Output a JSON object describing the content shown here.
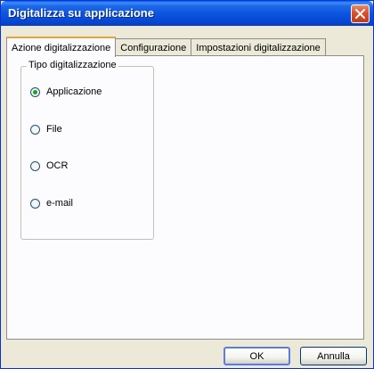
{
  "window": {
    "title": "Digitalizza su applicazione"
  },
  "tabs": [
    {
      "label": "Azione digitalizzazione",
      "active": true
    },
    {
      "label": "Configurazione",
      "active": false
    },
    {
      "label": "Impostazioni digitalizzazione",
      "active": false
    }
  ],
  "scan_type": {
    "legend": "Tipo digitalizzazione",
    "options": [
      {
        "label": "Applicazione",
        "selected": true
      },
      {
        "label": "File",
        "selected": false
      },
      {
        "label": "OCR",
        "selected": false
      },
      {
        "label": "e-mail",
        "selected": false
      }
    ]
  },
  "buttons": {
    "ok_label": "OK",
    "cancel_label": "Annulla"
  },
  "colors": {
    "titlebar": "#0a56e0",
    "close_button": "#d8512e",
    "active_tab_highlight": "#e8a33c",
    "radio_dot": "#21a121"
  }
}
